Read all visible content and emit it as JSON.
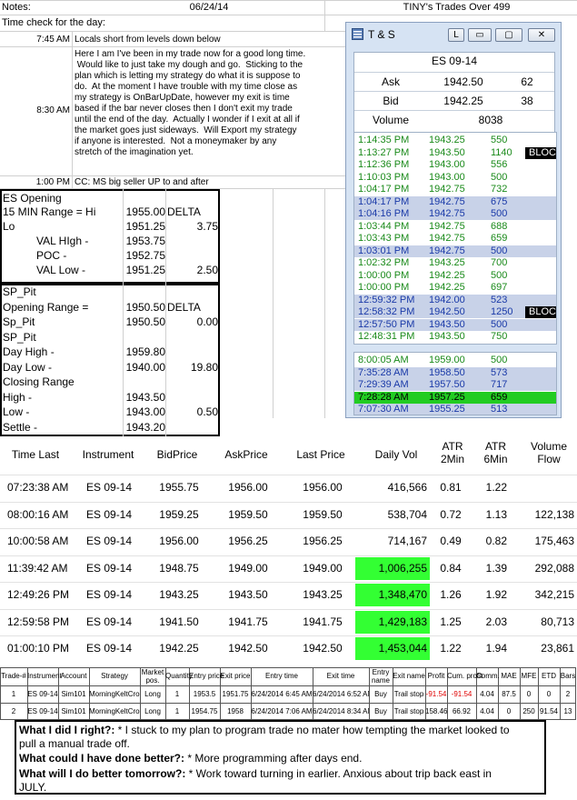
{
  "header": {
    "notes_label": "Notes:",
    "date": "06/24/14",
    "sheet_title": "TINY's Trades Over 499"
  },
  "timecheck": {
    "label": "Time check for the day:",
    "entries": [
      {
        "time": "7:45 AM",
        "text": "Locals short from levels down below"
      },
      {
        "time": "8:30 AM",
        "text": "Here I am I've been in my trade now for a good long time. Would like to just take my dough and go. Sticking to the plan which is letting my strategy do what it is suppose to do. At the moment I have trouble with my time close as my strategy is OnBarUpDate, however my exit is time based if the bar never closes then I don't exit my trade until the end of the day. Actually I wonder if I exit at all if the market goes just sideways. Will Export my strategy if anyone is interested. Not a moneymaker by any stretch of the imagination yet.",
        "lines": [
          "Here I am I've been in my trade now for a good long time.",
          " Would like to just take my dough and go.  Sticking to the",
          "plan which is letting my strategy do what it is suppose to",
          "do.  At the moment I have trouble with my time close as",
          "my strategy is OnBarUpDate, however my exit is time",
          "based if the bar never closes then I don't exit my trade",
          "until the end of the day.  Actually I wonder if I exit at all if",
          "the market goes just sideways.  Will Export my strategy",
          "if anyone is interested.  Not a moneymaker by any",
          "stretch of the imagination yet."
        ]
      },
      {
        "time": "1:00 PM",
        "text": "CC: MS big seller UP to and after"
      }
    ]
  },
  "es_opening": {
    "title": "ES Opening",
    "rows": [
      {
        "label": "15 MIN Range = Hi",
        "value": "1955.00",
        "extra": "DELTA"
      },
      {
        "label": "Lo",
        "value": "1951.25",
        "extra": "3.75"
      },
      {
        "label": "VAL HIgh  -",
        "value": "1953.75",
        "extra": ""
      },
      {
        "label": "POC  -",
        "value": "1952.75",
        "extra": ""
      },
      {
        "label": "VAL Low  -",
        "value": "1951.25",
        "extra": "2.50"
      }
    ]
  },
  "sp_pit": {
    "rows": [
      {
        "label": "SP_Pit",
        "value": "",
        "extra": ""
      },
      {
        "label": "Opening Range =",
        "value": "1950.50",
        "extra": "DELTA"
      },
      {
        "label": "Sp_Pit",
        "value": "1950.50",
        "extra": "0.00"
      },
      {
        "label": "SP_Pit",
        "value": "",
        "extra": ""
      },
      {
        "label": "Day High -",
        "value": "1959.80",
        "extra": ""
      },
      {
        "label": "Day Low -",
        "value": "1940.00",
        "extra": "19.80"
      },
      {
        "label": "Closing Range",
        "value": "",
        "extra": ""
      },
      {
        "label": "High -",
        "value": "1943.50",
        "extra": ""
      },
      {
        "label": "Low -",
        "value": "1943.00",
        "extra": "0.50"
      },
      {
        "label": "Settle -",
        "value": "1943.20",
        "extra": ""
      }
    ]
  },
  "ts_window": {
    "title": "T & S",
    "btn_l": "L",
    "instrument": "ES 09-14",
    "quote": [
      {
        "label": "Ask",
        "price": "1942.50",
        "size": "62"
      },
      {
        "label": "Bid",
        "price": "1942.25",
        "size": "38"
      },
      {
        "label": "Volume",
        "price": "8038",
        "size": ""
      }
    ],
    "colors": {
      "up": "#1a3aa8",
      "down": "#1a8a1a",
      "highlight_row": "#c8d2e8",
      "green_row": "#22cc22"
    },
    "tape1": [
      {
        "time": "1:14:35 PM",
        "price": "1943.25",
        "size": "550",
        "color": "green",
        "bg": "",
        "tag": ""
      },
      {
        "time": "1:13:27 PM",
        "price": "1943.50",
        "size": "1140",
        "color": "green",
        "bg": "",
        "tag": "BLOCK"
      },
      {
        "time": "1:12:36 PM",
        "price": "1943.00",
        "size": "556",
        "color": "green",
        "bg": "",
        "tag": ""
      },
      {
        "time": "1:10:03 PM",
        "price": "1943.00",
        "size": "500",
        "color": "green",
        "bg": "",
        "tag": ""
      },
      {
        "time": "1:04:17 PM",
        "price": "1942.75",
        "size": "732",
        "color": "green",
        "bg": "",
        "tag": ""
      },
      {
        "time": "1:04:17 PM",
        "price": "1942.75",
        "size": "675",
        "color": "blue",
        "bg": "hl",
        "tag": ""
      },
      {
        "time": "1:04:16 PM",
        "price": "1942.75",
        "size": "500",
        "color": "blue",
        "bg": "hl",
        "tag": ""
      },
      {
        "time": "1:03:44 PM",
        "price": "1942.75",
        "size": "688",
        "color": "green",
        "bg": "",
        "tag": ""
      },
      {
        "time": "1:03:43 PM",
        "price": "1942.75",
        "size": "659",
        "color": "green",
        "bg": "",
        "tag": ""
      },
      {
        "time": "1:03:01 PM",
        "price": "1942.75",
        "size": "500",
        "color": "blue",
        "bg": "hl",
        "tag": ""
      },
      {
        "time": "1:02:32 PM",
        "price": "1943.25",
        "size": "700",
        "color": "green",
        "bg": "",
        "tag": ""
      },
      {
        "time": "1:00:00 PM",
        "price": "1942.25",
        "size": "500",
        "color": "green",
        "bg": "",
        "tag": ""
      },
      {
        "time": "1:00:00 PM",
        "price": "1942.25",
        "size": "697",
        "color": "green",
        "bg": "",
        "tag": ""
      },
      {
        "time": "12:59:32 PM",
        "price": "1942.00",
        "size": "523",
        "color": "blue",
        "bg": "hl",
        "tag": ""
      },
      {
        "time": "12:58:32 PM",
        "price": "1942.50",
        "size": "1250",
        "color": "blue",
        "bg": "hl",
        "tag": "BLOCK"
      },
      {
        "time": "12:57:50 PM",
        "price": "1943.50",
        "size": "500",
        "color": "blue",
        "bg": "hl",
        "tag": ""
      },
      {
        "time": "12:48:31 PM",
        "price": "1943.50",
        "size": "750",
        "color": "green",
        "bg": "",
        "tag": ""
      }
    ],
    "tape2": [
      {
        "time": "8:00:05 AM",
        "price": "1959.00",
        "size": "500",
        "color": "green",
        "bg": ""
      },
      {
        "time": "7:35:28 AM",
        "price": "1958.50",
        "size": "573",
        "color": "blue",
        "bg": "hl"
      },
      {
        "time": "7:29:39 AM",
        "price": "1957.50",
        "size": "717",
        "color": "blue",
        "bg": "hl"
      },
      {
        "time": "7:28:28 AM",
        "price": "1957.25",
        "size": "659",
        "color": "black",
        "bg": "green"
      },
      {
        "time": "7:07:30 AM",
        "price": "1955.25",
        "size": "513",
        "color": "blue",
        "bg": "hl"
      }
    ]
  },
  "market_table": {
    "headers": [
      "Time Last",
      "Instrument",
      "BidPrice",
      "AskPrice",
      "Last Price",
      "Daily Vol",
      "ATR\n2Min",
      "ATR\n6Min",
      "Volume\nFlow"
    ],
    "rows": [
      {
        "time": "07:23:38 AM",
        "inst": "ES 09-14",
        "bid": "1955.75",
        "ask": "1956.00",
        "last": "1956.00",
        "vol": "416,566",
        "atr2": "0.81",
        "atr6": "1.22",
        "flow": "",
        "hl": false
      },
      {
        "time": "08:00:16 AM",
        "inst": "ES 09-14",
        "bid": "1959.25",
        "ask": "1959.50",
        "last": "1959.50",
        "vol": "538,704",
        "atr2": "0.72",
        "atr6": "1.13",
        "flow": "122,138",
        "hl": false
      },
      {
        "time": "10:00:58 AM",
        "inst": "ES 09-14",
        "bid": "1956.00",
        "ask": "1956.25",
        "last": "1956.25",
        "vol": "714,167",
        "atr2": "0.49",
        "atr6": "0.82",
        "flow": "175,463",
        "hl": false
      },
      {
        "time": "11:39:42 AM",
        "inst": "ES 09-14",
        "bid": "1948.75",
        "ask": "1949.00",
        "last": "1949.00",
        "vol": "1,006,255",
        "atr2": "0.84",
        "atr6": "1.39",
        "flow": "292,088",
        "hl": true
      },
      {
        "time": "12:49:26 PM",
        "inst": "ES 09-14",
        "bid": "1943.25",
        "ask": "1943.50",
        "last": "1943.25",
        "vol": "1,348,470",
        "atr2": "1.26",
        "atr6": "1.92",
        "flow": "342,215",
        "hl": true
      },
      {
        "time": "12:59:58 PM",
        "inst": "ES 09-14",
        "bid": "1941.50",
        "ask": "1941.75",
        "last": "1941.75",
        "vol": "1,429,183",
        "atr2": "1.25",
        "atr6": "2.03",
        "flow": "80,713",
        "hl": true
      },
      {
        "time": "01:00:10 PM",
        "inst": "ES 09-14",
        "bid": "1942.25",
        "ask": "1942.50",
        "last": "1942.50",
        "vol": "1,453,044",
        "atr2": "1.22",
        "atr6": "1.94",
        "flow": "23,861",
        "hl": true
      }
    ]
  },
  "trades_table": {
    "headers": [
      "Trade-#",
      "Instrument",
      "Account",
      "Strategy",
      "Market\npos.",
      "Quantity",
      "Entry price",
      "Exit price",
      "Entry time",
      "Exit time",
      "Entry\nname",
      "Exit name",
      "Profit",
      "Cum. profit",
      "Comm.",
      "MAE",
      "MFE",
      "ETD",
      "Bars"
    ],
    "rows": [
      [
        "1",
        "ES 09-14",
        "Sim101",
        "MorningKeltCross",
        "Long",
        "1",
        "1953.5",
        "1951.75",
        "6/24/2014 6:45 AM",
        "6/24/2014 6:52 AM",
        "Buy",
        "Trail stop",
        "-91.54",
        "-91.54",
        "4.04",
        "87.5",
        "0",
        "0",
        "2"
      ],
      [
        "2",
        "ES 09-14",
        "Sim101",
        "MorningKeltCross",
        "Long",
        "1",
        "1954.75",
        "1958",
        "6/24/2014 7:06 AM",
        "6/24/2014 8:34 AM",
        "Buy",
        "Trail stop",
        "158.46",
        "66.92",
        "4.04",
        "0",
        "250",
        "91.54",
        "13"
      ]
    ]
  },
  "review": {
    "q1": "What I did I right?:",
    "a1": " * I stuck to my plan to program trade no mater how tempting the market looked to",
    "a1b": "pull a manual trade off.",
    "q2": "What could I have done better?:",
    "a2": " * More programming after days end.",
    "q3": "What will I do better tomorrow?:",
    "a3": " * Work toward turning in earlier.  Anxious about trip back east in",
    "a3b": "JULY."
  }
}
